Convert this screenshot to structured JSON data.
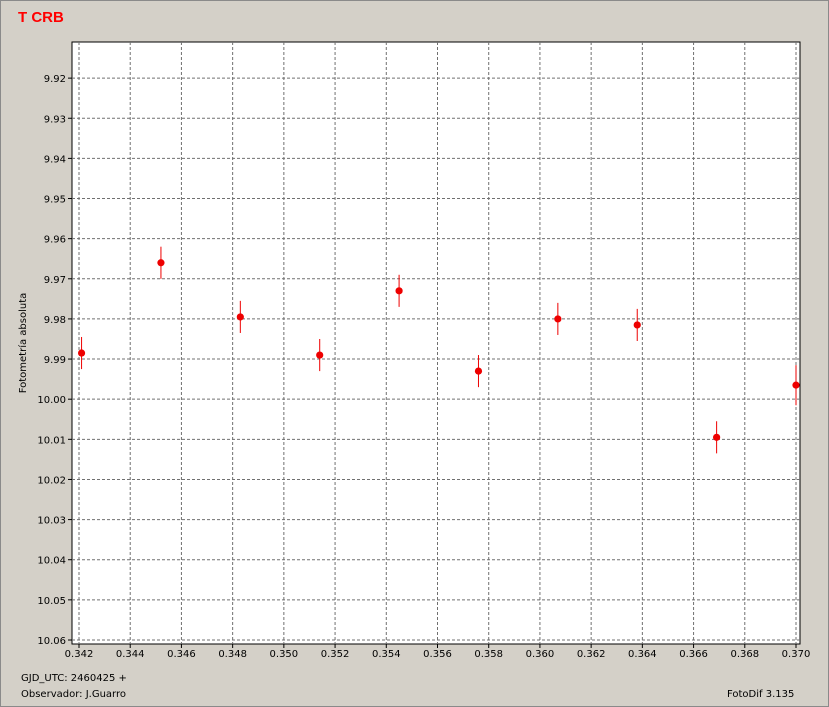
{
  "window": {
    "title": "T CRB",
    "title_color": "#ff0000",
    "background": "#d4d0c8"
  },
  "footer": {
    "gjd": "GJD_UTC: 2460425 +",
    "observer": "Observador: J.Guarro",
    "software": "FotoDif 3.135"
  },
  "chart_data": {
    "type": "scatter",
    "title": "T CRB",
    "xlabel": "",
    "ylabel": "Fotometría absoluta",
    "xlim": [
      0.342,
      0.37
    ],
    "ylim": [
      9.911,
      10.061
    ],
    "y_inverted": true,
    "grid": true,
    "grid_style": "dashed",
    "x_ticks": [
      "0.342",
      "0.344",
      "0.346",
      "0.348",
      "0.350",
      "0.352",
      "0.354",
      "0.356",
      "0.358",
      "0.360",
      "0.362",
      "0.364",
      "0.366",
      "0.368",
      "0.370"
    ],
    "y_ticks": [
      "9.92",
      "9.93",
      "9.94",
      "9.95",
      "9.96",
      "9.97",
      "9.98",
      "9.99",
      "10.00",
      "10.01",
      "10.02",
      "10.03",
      "10.04",
      "10.05",
      "10.06"
    ],
    "point_color": "#ee0000",
    "series": [
      {
        "x": [
          0.3421,
          0.3452,
          0.3483,
          0.3514,
          0.3545,
          0.3576,
          0.3607,
          0.3638,
          0.3669,
          0.37
        ],
        "y": [
          9.9885,
          9.966,
          9.9795,
          9.989,
          9.973,
          9.993,
          9.98,
          9.9815,
          10.0095,
          9.9965
        ],
        "err": [
          0.004,
          0.004,
          0.004,
          0.004,
          0.004,
          0.004,
          0.004,
          0.004,
          0.004,
          0.005
        ]
      }
    ]
  }
}
